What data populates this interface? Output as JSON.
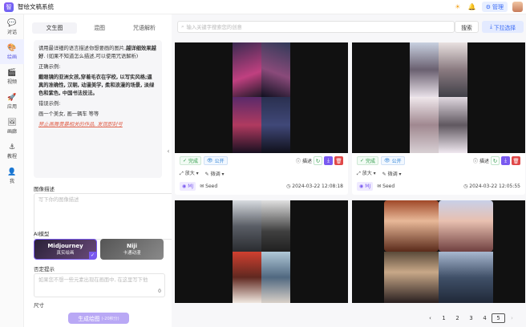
{
  "app": {
    "title": "智绘文稿系统",
    "logo_text": "智"
  },
  "topbar": {
    "sun_icon": "sun-icon",
    "bell_icon": "bell-icon",
    "admin_label": "管理"
  },
  "nav": [
    {
      "label": "对话",
      "icon": "chat-icon",
      "glyph": "💬"
    },
    {
      "label": "绘画",
      "icon": "paint-icon",
      "glyph": "🎨"
    },
    {
      "label": "视频",
      "icon": "video-icon",
      "glyph": "🎬"
    },
    {
      "label": "应用",
      "icon": "rocket-icon",
      "glyph": "🚀"
    },
    {
      "label": "画廊",
      "icon": "gallery-icon",
      "glyph": "🖼"
    },
    {
      "label": "教程",
      "icon": "anchor-icon",
      "glyph": "⚓"
    },
    {
      "label": "我",
      "icon": "user-icon",
      "glyph": "👤"
    }
  ],
  "form": {
    "tabs": [
      "文生图",
      "混图",
      "咒语解析"
    ],
    "tip": {
      "intro_a": "请用最详细的语言描述你想要画的图片,",
      "intro_b": "越详细效果越好",
      "intro_c": ". (如果不知道怎么描述,可以使用咒语解析)",
      "correct_label": "正确示例:",
      "correct_text": "戴眼镜的亚洲女孩,穿着毛衣在学校, 以写实风格;逼真的准确性, 汉朝, 动漫美学, 柔和浪漫的场景, 淡绿色和紫色, 中国书法技法。",
      "wrong_label": "错误示例:",
      "wrong_text": "画一个美女, 画一辆车 等等",
      "warning": "禁止画舞黄暴相关的作品, 发现即封号"
    },
    "desc_label": "图像描述",
    "desc_placeholder": "写下你的图像描述",
    "desc_count": "0",
    "model_label": "AI模型",
    "models": [
      {
        "name": "Midjourney",
        "desc": "真实绘画"
      },
      {
        "name": "Niji",
        "desc": "卡通动漫"
      }
    ],
    "neg_label": "否定提示",
    "neg_placeholder": "如果您不想一些元素出现在画面中, 在这里写下他",
    "neg_count": "0",
    "size_label": "尺寸",
    "generate_label": "生成绘图",
    "generate_cost": "(-20积分)"
  },
  "toolbar": {
    "search_placeholder": "输入关键字搜索您的创意",
    "search_label": "搜索",
    "pull_label": "下拉选择"
  },
  "cards": [
    {
      "status": "完成",
      "public": "公开",
      "describe": "描述",
      "zoom": "放大",
      "tune": "微调",
      "model": "MJ",
      "seed": "Seed",
      "time": "2024-03-22 12:08:18"
    },
    {
      "status": "完成",
      "public": "公开",
      "describe": "描述",
      "zoom": "放大",
      "tune": "微调",
      "model": "MJ",
      "seed": "Seed",
      "time": "2024-03-22 12:05:55"
    }
  ],
  "pagination": {
    "pages": [
      "1",
      "2",
      "3",
      "4",
      "5"
    ],
    "current": "5"
  }
}
